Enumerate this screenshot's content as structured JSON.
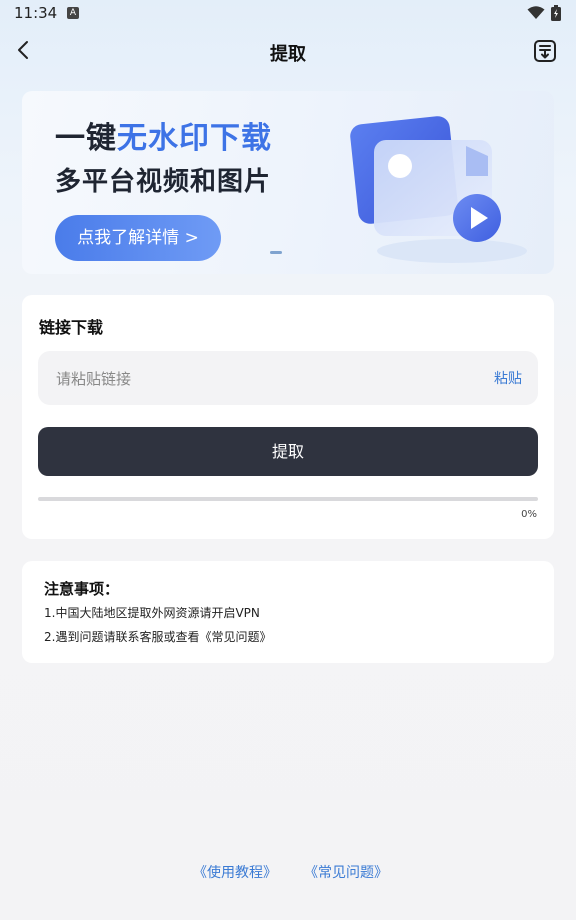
{
  "status_bar": {
    "time": "11:34",
    "notification_badge": "A"
  },
  "nav": {
    "title": "提取",
    "icons": [
      "chevron-left-icon",
      "download-list-icon"
    ]
  },
  "banner": {
    "line1_prefix": "一键",
    "line1_accent": "无水印下载",
    "line2": "多平台视频和图片",
    "cta": "点我了解详情 >",
    "accent_color": "#3d73e6"
  },
  "link_card": {
    "title": "链接下载",
    "input_value": "",
    "input_placeholder": "请粘贴链接",
    "paste_label": "粘贴",
    "extract_label": "提取",
    "progress_fraction": 0,
    "progress_text": "0%"
  },
  "notes": {
    "title": "注意事项：",
    "items": [
      "1.中国大陆地区提取外网资源请开启VPN",
      "2.遇到问题请联系客服或查看《常见问题》"
    ]
  },
  "footer": {
    "tutorial": "《使用教程》",
    "faq": "《常见问题》"
  },
  "colors": {
    "link_blue": "#3b7bd4",
    "button_dark": "#2f333f"
  }
}
